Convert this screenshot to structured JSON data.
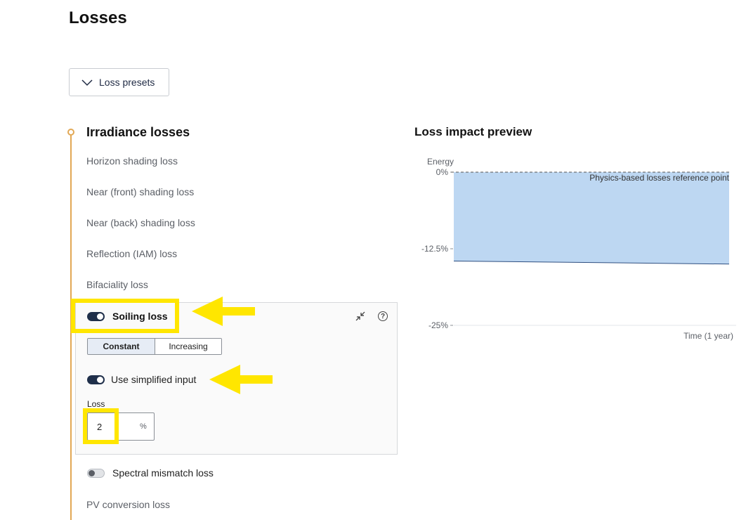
{
  "page": {
    "title": "Losses"
  },
  "presets": {
    "label": "Loss presets",
    "icon": "chevron-down-icon"
  },
  "irradiance": {
    "title": "Irradiance losses",
    "items": [
      "Horizon shading loss",
      "Near (front) shading loss",
      "Near (back) shading loss",
      "Reflection (IAM) loss",
      "Bifaciality loss"
    ],
    "soiling": {
      "label": "Soiling loss",
      "enabled": true,
      "modes": {
        "active": "Constant",
        "other": "Increasing"
      },
      "simplified": {
        "label": "Use simplified input",
        "enabled": true
      },
      "loss": {
        "label": "Loss",
        "value": "2",
        "unit": "%"
      },
      "icons": {
        "collapse": "collapse-icon",
        "help": "help-icon"
      }
    },
    "spectral": {
      "label": "Spectral mismatch loss",
      "enabled": false
    },
    "pv_conversion": {
      "label": "PV conversion loss"
    }
  },
  "colors": {
    "accent": "#e2a855",
    "highlight": "#ffe600",
    "toggle_on": "#1f2f4a",
    "chart_fill": "#bdd7f2"
  },
  "chart_data": {
    "type": "area",
    "title": "Loss impact preview",
    "ylabel": "Energy",
    "xlabel": "Time (1 year)",
    "y_ticks": [
      "0%",
      "-12.5%",
      "-25%"
    ],
    "ylim": [
      -25,
      0
    ],
    "x": [
      0,
      1
    ],
    "series": [
      {
        "values": [
          -14.5,
          -15
        ]
      }
    ],
    "reference": {
      "value": 0,
      "label": "Physics-based losses reference point"
    },
    "grid": false
  }
}
